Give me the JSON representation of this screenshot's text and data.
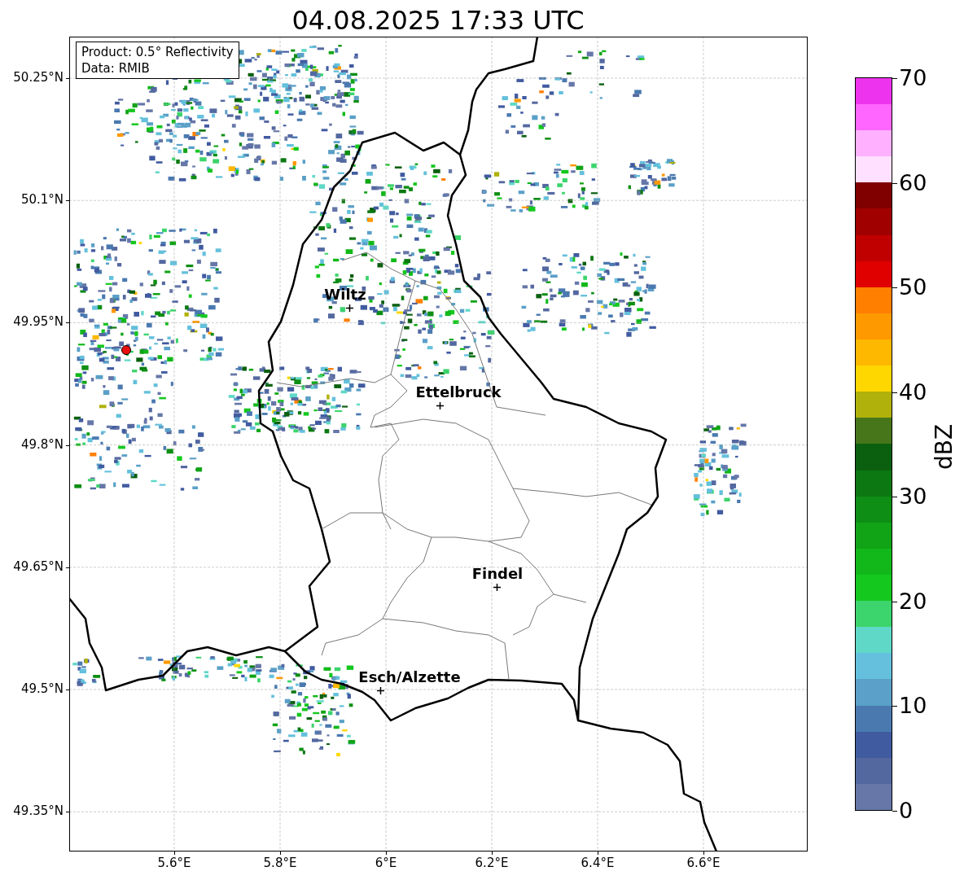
{
  "title": "04.08.2025 17:33 UTC",
  "info_box": [
    "Product: 0.5° Reflectivity",
    "Data: RMIB"
  ],
  "map": {
    "y_ticks": [
      "50.25°N",
      "50.1°N",
      "49.95°N",
      "49.8°N",
      "49.65°N",
      "49.5°N",
      "49.35°N"
    ],
    "x_ticks": [
      "5.6°E",
      "5.8°E",
      "6°E",
      "6.2°E",
      "6.4°E",
      "6.6°E"
    ],
    "cities": [
      {
        "name": "Wiltz"
      },
      {
        "name": "Ettelbruck"
      },
      {
        "name": "Findel"
      },
      {
        "name": "Esch/Alzette"
      }
    ]
  },
  "colorbar": {
    "label": "dBZ",
    "ticks": [
      "70",
      "60",
      "50",
      "40",
      "30",
      "20",
      "10",
      "0"
    ],
    "bins": [
      {
        "color": "#6677a8"
      },
      {
        "color": "#5468a0"
      },
      {
        "color": "#415ba0"
      },
      {
        "color": "#4a79b0"
      },
      {
        "color": "#5aa0c8"
      },
      {
        "color": "#64c0dc"
      },
      {
        "color": "#60d8c8"
      },
      {
        "color": "#3cd46c"
      },
      {
        "color": "#14c81e"
      },
      {
        "color": "#12b81a"
      },
      {
        "color": "#10a416"
      },
      {
        "color": "#0e8e14"
      },
      {
        "color": "#0c7812"
      },
      {
        "color": "#0a600e"
      },
      {
        "color": "#47761a"
      },
      {
        "color": "#b0b10a"
      },
      {
        "color": "#ffd700"
      },
      {
        "color": "#ffb800"
      },
      {
        "color": "#ff9900"
      },
      {
        "color": "#ff7f00"
      },
      {
        "color": "#e00000"
      },
      {
        "color": "#c00000"
      },
      {
        "color": "#a00000"
      },
      {
        "color": "#800000"
      },
      {
        "color": "#ffe0ff"
      },
      {
        "color": "#ffb0ff"
      },
      {
        "color": "#ff66ff"
      },
      {
        "color": "#ee33ee"
      }
    ]
  }
}
